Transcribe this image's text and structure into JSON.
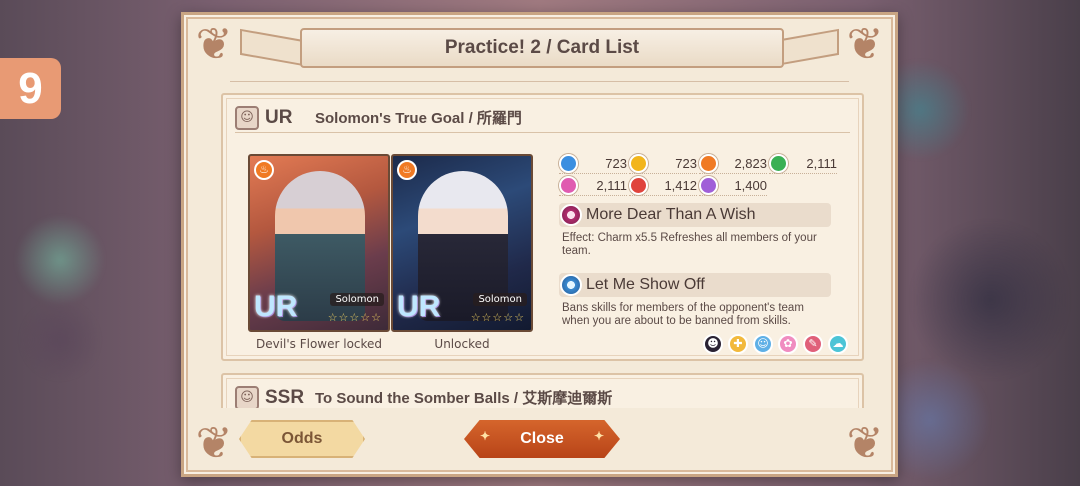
{
  "stage_badge": "9",
  "dialog": {
    "title": "Practice! 2 / Card List",
    "cards": [
      {
        "rarity": "UR",
        "name": "Solomon's True Goal / 所羅門",
        "art": [
          {
            "caption": "Devil's Flower locked",
            "badge": "UR",
            "character": "Solomon",
            "attribute_icon": "fire-icon"
          },
          {
            "caption": "Unlocked",
            "badge": "UR",
            "character": "Solomon",
            "attribute_icon": "fire-icon"
          }
        ],
        "stats": [
          {
            "icon": "water-attribute-icon",
            "color": "#3a8ee0",
            "value": "723"
          },
          {
            "icon": "wind-attribute-icon",
            "color": "#f2b51c",
            "value": "723"
          },
          {
            "icon": "fire-attribute-icon",
            "color": "#f07a24",
            "value": "2,823"
          },
          {
            "icon": "nature-attribute-icon",
            "color": "#39b054",
            "value": "2,111"
          },
          {
            "icon": "charm-attribute-icon",
            "color": "#e05bb0",
            "value": "2,111"
          },
          {
            "icon": "power-attribute-icon",
            "color": "#e0433c",
            "value": "1,412"
          },
          {
            "icon": "magic-attribute-icon",
            "color": "#a05fd8",
            "value": "1,400"
          }
        ],
        "skills": [
          {
            "name": "More Dear Than A Wish",
            "desc": "Effect: Charm x5.5 Refreshes all members of your team."
          },
          {
            "name": "Let Me Show Off",
            "desc": "Bans skills for members of the opponent's team when you are about to be banned from skills."
          }
        ],
        "tags": [
          {
            "icon": "demon-icon",
            "color": "#2a2233"
          },
          {
            "icon": "gift-icon",
            "color": "#f2b93c"
          },
          {
            "icon": "face-icon",
            "color": "#5fb0e6"
          },
          {
            "icon": "flower-icon",
            "color": "#f08cc0"
          },
          {
            "icon": "wrench-icon",
            "color": "#e0607a"
          },
          {
            "icon": "chat-icon",
            "color": "#4cc4d6"
          }
        ]
      },
      {
        "rarity": "SSR",
        "name": "To Sound the Somber Balls / 艾斯摩迪爾斯"
      }
    ],
    "buttons": {
      "odds": "Odds",
      "close": "Close"
    }
  }
}
